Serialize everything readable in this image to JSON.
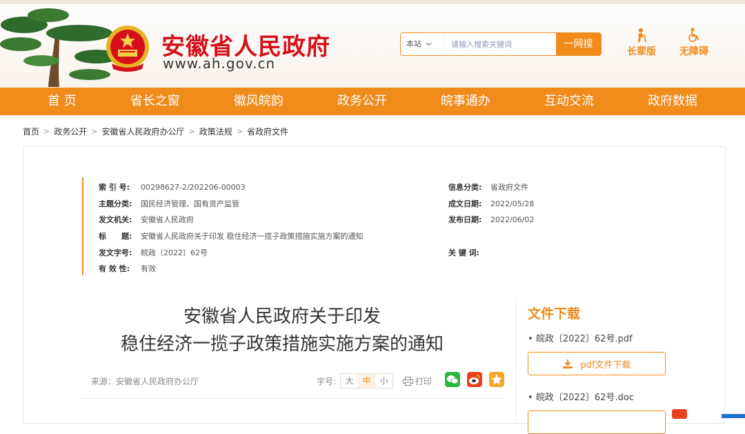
{
  "header": {
    "site_title": "安徽省人民政府",
    "site_url": "www.ah.gov.cn",
    "search": {
      "scope": "本站",
      "placeholder": "请输入搜索关键词",
      "button": "一网搜"
    },
    "links": [
      {
        "label": "长辈版",
        "icon": "elder-person-icon"
      },
      {
        "label": "无障碍",
        "icon": "wheelchair-icon"
      }
    ]
  },
  "nav": [
    {
      "label": "首 页"
    },
    {
      "label": "省长之窗"
    },
    {
      "label": "徽风皖韵"
    },
    {
      "label": "政务公开"
    },
    {
      "label": "皖事通办"
    },
    {
      "label": "互动交流"
    },
    {
      "label": "政府数据"
    }
  ],
  "breadcrumb": [
    "首页",
    "政务公开",
    "安徽省人民政府办公厅",
    "政策法规",
    "省政府文件"
  ],
  "meta": {
    "left": [
      {
        "key": "索 引 号:",
        "value": "00298627-2/202206-00003"
      },
      {
        "key": "主题分类:",
        "value": "国民经济管理、国有资产监管"
      },
      {
        "key": "发文机关:",
        "value": "安徽省人民政府"
      },
      {
        "key": "标　　题:",
        "value": "安徽省人民政府关于印发 稳住经济一揽子政策措施实施方案的通知"
      },
      {
        "key": "发文字号:",
        "value": "皖政〔2022〕62号"
      },
      {
        "key": "有 效 性:",
        "value": "有效"
      }
    ],
    "right": [
      {
        "key": "信息分类:",
        "value": "省政府文件"
      },
      {
        "key": "成文日期:",
        "value": "2022/05/28"
      },
      {
        "key": "发布日期:",
        "value": "2022/06/02"
      },
      {
        "key": "关 键 词:",
        "value": ""
      }
    ]
  },
  "article": {
    "title_line1": "安徽省人民政府关于印发",
    "title_line2": "稳住经济一揽子政策措施实施方案的通知",
    "source": "来源：安徽省人民政府办公厅",
    "font_size_label": "字号:",
    "font_sizes": [
      "大",
      "中",
      "小"
    ],
    "font_size_selected": "中",
    "print_label": "打印",
    "share_icons": [
      {
        "icon": "wechat-icon",
        "color": "#2db73a"
      },
      {
        "icon": "weibo-icon",
        "color": "#e8411c"
      },
      {
        "icon": "qzone-star-icon",
        "color": "#f4a72a"
      }
    ]
  },
  "downloads": {
    "title": "文件下载",
    "files": [
      {
        "name": "皖政〔2022〕62号.pdf",
        "button": "pdf文件下载"
      },
      {
        "name": "皖政〔2022〕62号.doc",
        "button": ""
      }
    ]
  },
  "colors": {
    "accent": "#f08b1c",
    "brand_red": "#d5101a"
  }
}
